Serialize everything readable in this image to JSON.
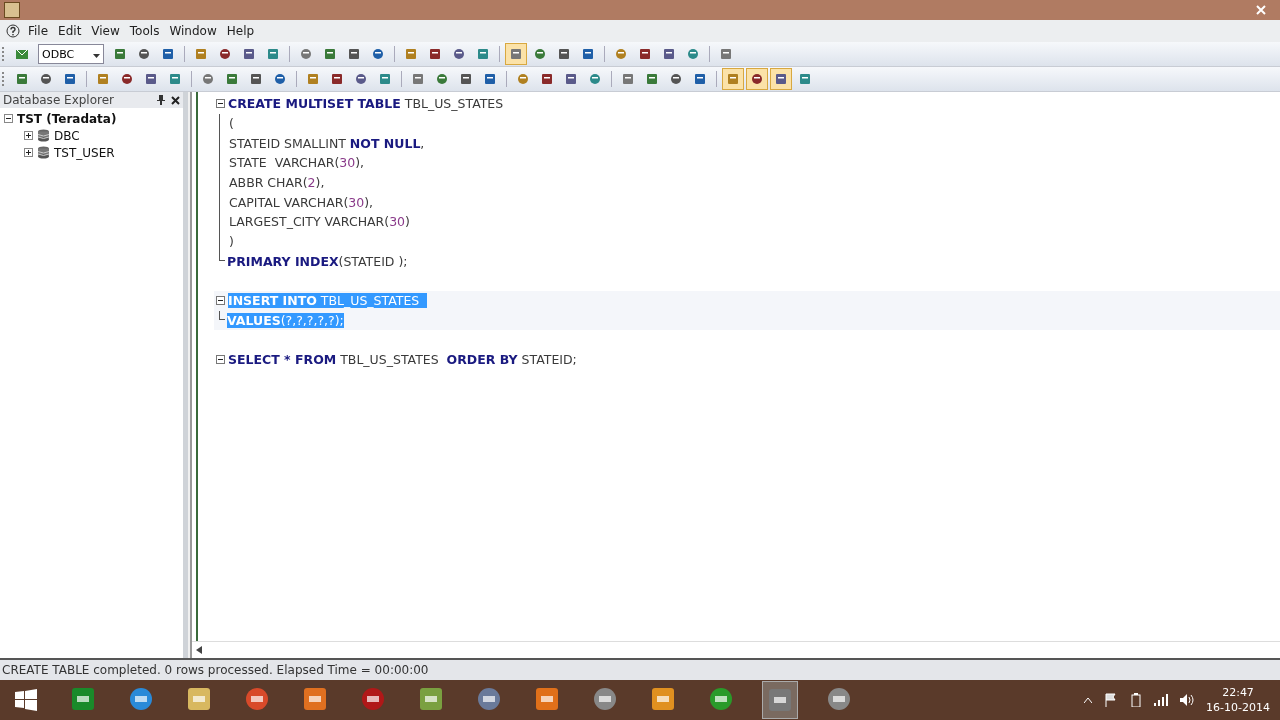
{
  "menu": [
    "File",
    "Edit",
    "View",
    "Tools",
    "Window",
    "Help"
  ],
  "toolbar_1": {
    "source": "ODBC",
    "buttons": [
      {
        "on": false
      },
      {
        "on": false
      },
      {
        "on": false
      },
      {
        "on": false
      },
      {
        "on": false
      },
      {
        "on": false
      },
      {
        "on": false
      },
      {
        "on": false
      },
      {
        "on": false
      },
      {
        "on": false
      },
      {
        "on": false
      },
      {
        "on": false
      },
      {
        "on": false
      },
      {
        "on": false
      },
      {
        "on": false
      },
      {
        "on": true
      },
      {
        "on": false
      },
      {
        "on": false
      },
      {
        "on": false
      },
      {
        "on": false
      },
      {
        "on": false
      },
      {
        "on": false
      },
      {
        "on": false
      },
      {
        "on": false
      }
    ]
  },
  "toolbar_2": {
    "buttons": [
      {
        "on": false
      },
      {
        "on": false
      },
      {
        "on": false
      },
      {
        "on": false
      },
      {
        "on": false
      },
      {
        "on": false
      },
      {
        "on": false
      },
      {
        "on": false
      },
      {
        "on": false
      },
      {
        "on": false
      },
      {
        "on": false
      },
      {
        "on": false
      },
      {
        "on": false
      },
      {
        "on": false
      },
      {
        "on": false
      },
      {
        "on": false
      },
      {
        "on": false
      },
      {
        "on": false
      },
      {
        "on": false
      },
      {
        "on": false
      },
      {
        "on": false
      },
      {
        "on": false
      },
      {
        "on": false
      },
      {
        "on": false
      },
      {
        "on": false
      },
      {
        "on": false
      },
      {
        "on": false
      },
      {
        "on": true
      },
      {
        "on": true
      },
      {
        "on": true
      },
      {
        "on": false
      }
    ]
  },
  "explorer": {
    "title": "Database Explorer",
    "tree": [
      {
        "label": "TST (Teradata)",
        "expanded": true,
        "children": [
          {
            "label": "DBC",
            "expanded": false
          },
          {
            "label": "TST_USER",
            "expanded": false
          }
        ]
      }
    ]
  },
  "editor": {
    "statements": [
      {
        "selected": false,
        "lines": [
          [
            {
              "kind": "keyword",
              "text": "CREATE MULTISET TABLE"
            },
            {
              "kind": "name",
              "text": " TBL_US_STATES"
            }
          ],
          [
            {
              "kind": "name",
              "text": "("
            }
          ],
          [
            {
              "kind": "name",
              "text": "STATEID SMALLINT "
            },
            {
              "kind": "keyword",
              "text": "NOT NULL"
            },
            {
              "kind": "name",
              "text": ","
            }
          ],
          [
            {
              "kind": "name",
              "text": "STATE  VARCHAR("
            },
            {
              "kind": "number",
              "text": "30"
            },
            {
              "kind": "name",
              "text": "),"
            }
          ],
          [
            {
              "kind": "name",
              "text": "ABBR CHAR("
            },
            {
              "kind": "number",
              "text": "2"
            },
            {
              "kind": "name",
              "text": "),"
            }
          ],
          [
            {
              "kind": "name",
              "text": "CAPITAL VARCHAR("
            },
            {
              "kind": "number",
              "text": "30"
            },
            {
              "kind": "name",
              "text": "),"
            }
          ],
          [
            {
              "kind": "name",
              "text": "LARGEST_CITY VARCHAR("
            },
            {
              "kind": "number",
              "text": "30"
            },
            {
              "kind": "name",
              "text": ")"
            }
          ],
          [
            {
              "kind": "name",
              "text": ")"
            }
          ],
          [
            {
              "kind": "keyword",
              "text": "PRIMARY INDEX"
            },
            {
              "kind": "name",
              "text": "(STATEID );"
            }
          ]
        ]
      },
      {
        "selected": true,
        "lines": [
          [
            {
              "kind": "keyword",
              "text": "INSERT INTO"
            },
            {
              "kind": "name",
              "text": " TBL_US_STATES  "
            }
          ],
          [
            {
              "kind": "keyword",
              "text": "VALUES"
            },
            {
              "kind": "name",
              "text": "(?,?,?,?,?);"
            }
          ]
        ]
      },
      {
        "selected": false,
        "lines": [
          [
            {
              "kind": "keyword",
              "text": "SELECT * FROM"
            },
            {
              "kind": "name",
              "text": " TBL_US_STATES  "
            },
            {
              "kind": "keyword",
              "text": "ORDER BY"
            },
            {
              "kind": "name",
              "text": " STATEID;"
            }
          ]
        ]
      }
    ]
  },
  "status_bar": "CREATE TABLE completed. 0 rows processed. Elapsed Time =  00:00:00",
  "taskbar": {
    "apps": [
      {
        "selected": false
      },
      {
        "selected": false
      },
      {
        "selected": false
      },
      {
        "selected": false
      },
      {
        "selected": false
      },
      {
        "selected": false
      },
      {
        "selected": false
      },
      {
        "selected": false
      },
      {
        "selected": false
      },
      {
        "selected": false
      },
      {
        "selected": false
      },
      {
        "selected": false
      },
      {
        "selected": true
      },
      {
        "selected": false
      }
    ],
    "time": "22:47",
    "date": "16-10-2014"
  }
}
